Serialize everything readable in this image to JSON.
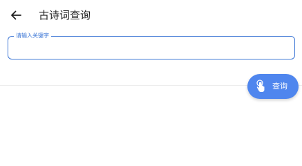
{
  "header": {
    "title": "古诗词查询",
    "back_icon": "arrow-back-icon"
  },
  "search": {
    "label": "请输入关键字",
    "value": "",
    "accent_color": "#3f78d6"
  },
  "fab": {
    "label": "查询",
    "icon": "touch-icon",
    "color": "#4f86ee"
  }
}
